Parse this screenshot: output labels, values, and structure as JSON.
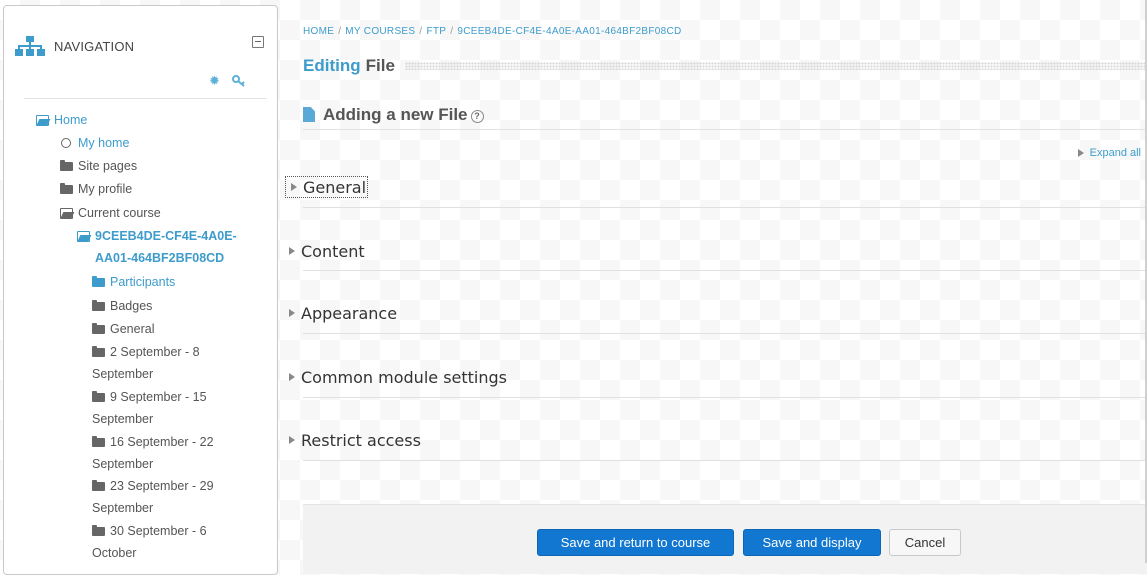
{
  "navigation": {
    "title": "NAVIGATION",
    "items": [
      {
        "label": "Home",
        "icon": "folder-open-icon"
      },
      {
        "label": "My home",
        "icon": "circle-icon"
      },
      {
        "label": "Site pages",
        "icon": "folder-icon"
      },
      {
        "label": "My profile",
        "icon": "folder-icon"
      },
      {
        "label": "Current course",
        "icon": "folder-open-icon"
      },
      {
        "label": "9CEEB4DE-CF4E-4A0E-AA01-464BF2BF08CD",
        "icon": "folder-open-icon"
      },
      {
        "label": "Participants",
        "icon": "folder-icon"
      },
      {
        "label": "Badges",
        "icon": "folder-icon"
      },
      {
        "label": "General",
        "icon": "folder-icon"
      },
      {
        "label": "2 September - 8 September",
        "icon": "folder-icon"
      },
      {
        "label": "9 September - 15 September",
        "icon": "folder-icon"
      },
      {
        "label": "16 September - 22 September",
        "icon": "folder-icon"
      },
      {
        "label": "23 September - 29 September",
        "icon": "folder-icon"
      },
      {
        "label": "30 September - 6 October",
        "icon": "folder-icon"
      }
    ]
  },
  "breadcrumb": [
    "HOME",
    "MY COURSES",
    "FTP",
    "9CEEB4DE-CF4E-4A0E-AA01-464BF2BF08CD"
  ],
  "heading": {
    "accent": "Editing",
    "rest": "File"
  },
  "subheading": {
    "text": "Adding a new File",
    "help": "?"
  },
  "expand_all": "Expand all",
  "sections": [
    "General",
    "Content",
    "Appearance",
    "Common module settings",
    "Restrict access"
  ],
  "buttons": {
    "save_return": "Save and return to course",
    "save_display": "Save and display",
    "cancel": "Cancel"
  },
  "colors": {
    "link": "#3d9ccc",
    "primary_button": "#1177d1"
  }
}
